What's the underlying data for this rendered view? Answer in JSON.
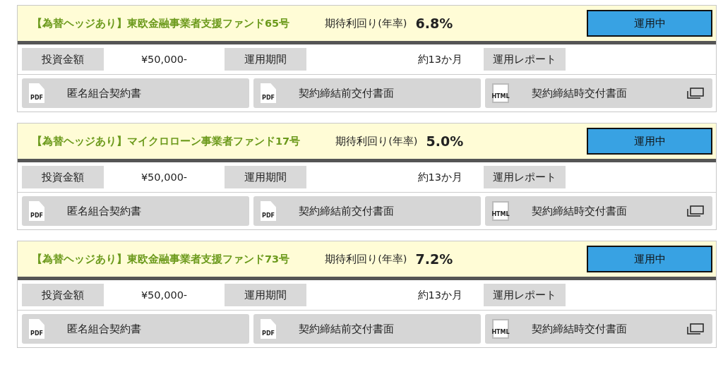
{
  "funds": [
    {
      "title": "【為替ヘッジあり】東欧金融事業者支援ファンド65号",
      "yield_label": "期待利回り(年率)",
      "yield": "6.8%",
      "status": "運用中",
      "amount_label": "投資金額",
      "amount": "¥50,000-",
      "period_label": "運用期間",
      "period": "約13か月",
      "report": "運用レポート",
      "documents": [
        {
          "kind": "pdf",
          "icon_text": "PDF",
          "label": "匿名組合契約書",
          "external": false
        },
        {
          "kind": "pdf",
          "icon_text": "PDF",
          "label": "契約締結前交付書面",
          "external": false
        },
        {
          "kind": "html",
          "icon_text": "HTML",
          "label": "契約締結時交付書面",
          "external": true
        }
      ]
    },
    {
      "title": "【為替ヘッジあり】マイクロローン事業者ファンド17号",
      "yield_label": "期待利回り(年率)",
      "yield": "5.0%",
      "status": "運用中",
      "amount_label": "投資金額",
      "amount": "¥50,000-",
      "period_label": "運用期間",
      "period": "約13か月",
      "report": "運用レポート",
      "documents": [
        {
          "kind": "pdf",
          "icon_text": "PDF",
          "label": "匿名組合契約書",
          "external": false
        },
        {
          "kind": "pdf",
          "icon_text": "PDF",
          "label": "契約締結前交付書面",
          "external": false
        },
        {
          "kind": "html",
          "icon_text": "HTML",
          "label": "契約締結時交付書面",
          "external": true
        }
      ]
    },
    {
      "title": "【為替ヘッジあり】東欧金融事業者支援ファンド73号",
      "yield_label": "期待利回り(年率)",
      "yield": "7.2%",
      "status": "運用中",
      "amount_label": "投資金額",
      "amount": "¥50,000-",
      "period_label": "運用期間",
      "period": "約13か月",
      "report": "運用レポート",
      "documents": [
        {
          "kind": "pdf",
          "icon_text": "PDF",
          "label": "匿名組合契約書",
          "external": false
        },
        {
          "kind": "pdf",
          "icon_text": "PDF",
          "label": "契約締結前交付書面",
          "external": false
        },
        {
          "kind": "html",
          "icon_text": "HTML",
          "label": "契約締結時交付書面",
          "external": true
        }
      ]
    }
  ]
}
